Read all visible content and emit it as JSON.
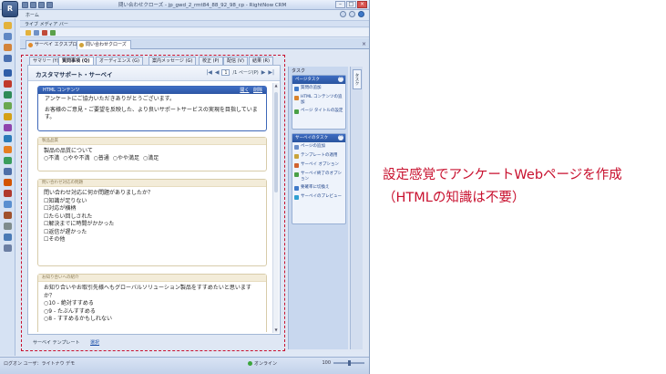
{
  "window": {
    "title": "問い合わせクローズ - jp_gwd_2_rmt84_88_92_98_cp - RightNow CRM",
    "orb_label": "R",
    "home_tab": "ホーム",
    "live_media_bar": "ライブ メディア バー",
    "win_min": "–",
    "win_max": "□",
    "win_close": "×"
  },
  "doc_tabs": [
    {
      "label": "サーベイ エクスプローラ"
    },
    {
      "label": "問い合わせクローズ"
    }
  ],
  "doc_close": "×",
  "subtabs": [
    {
      "label": "サマリー (Y)",
      "active": false
    },
    {
      "label": "質問事項 (Q)",
      "active": true
    },
    {
      "label": "オーディエンス (G)",
      "active": false
    },
    {
      "label": "案内メッセージ (G)",
      "active": false
    },
    {
      "label": "校正 (P)",
      "active": false
    },
    {
      "label": "配信 (V)",
      "active": false
    },
    {
      "label": "結果 (R)",
      "active": false
    }
  ],
  "survey": {
    "title": "カスタマサポート・サーベイ",
    "pager": {
      "first": "|◀",
      "prev": "◀",
      "page": "1",
      "of_text": "/1 ページ(P)",
      "next": "▶",
      "last": "▶|"
    },
    "html_content": {
      "header": "HTML コンテンツ",
      "link_edit": "開く",
      "link_delete": "削除",
      "para1": "アンケートにご協力いただきありがとうございます。",
      "para2": "お客様のご意見・ご要望を反映した、より良いサポートサービスの実現を目指しています。"
    },
    "questions": [
      {
        "header": "製品品質",
        "text": "製品の品質について",
        "options": [
          "○不満",
          "○やや不満",
          "○普通",
          "○やや満足",
          "○満足"
        ]
      },
      {
        "header": "問い合わせ対応の問題",
        "text": "問い合わせ対応に何か問題がありましたか？",
        "options": [
          "☐知識が足りない",
          "☐対応が横柄",
          "☐たらい回しされた",
          "☐解決までに時間がかかった",
          "☐返信が遅かった",
          "☐その他"
        ]
      },
      {
        "header": "お知り合いへの紹介",
        "text": "お知り合いやお取引先様へもグローバルソリューション製品をすすめたいと思いますか？",
        "options": [
          "○10 - 絶対すすめる",
          "○9 - たぶんすすめる",
          "○8 - すすめるかもしれない"
        ]
      }
    ]
  },
  "bottom_bar": {
    "label": "サーベイ テンプレート",
    "link": "選択"
  },
  "task_pane": {
    "title": "タスク",
    "tab_label": "タスク",
    "sections": [
      {
        "header": "ページタスク",
        "items": [
          "質問の追加",
          "HTML コンテンツの追加",
          "ページ タイトルの設定"
        ]
      },
      {
        "header": "サーベイのタスク",
        "items": [
          "ページの追加",
          "テンプレートの適用",
          "サーベイ オプション",
          "サーベイ終了のオプション",
          "要確率に切換え",
          "サーベイのプレビュー"
        ]
      }
    ]
  },
  "statusbar": {
    "left": "ログオン ユーザ：ライトナウ デモ",
    "online": "オンライン",
    "zoom": "100",
    "zoom_level": 0.5
  },
  "caption": {
    "line1": "設定感覚でアンケートWebページを作成",
    "line2": "（HTMLの知識は不要）"
  },
  "colors": {
    "accent_red": "#c8102e",
    "header_blue": "#2c55a3"
  }
}
